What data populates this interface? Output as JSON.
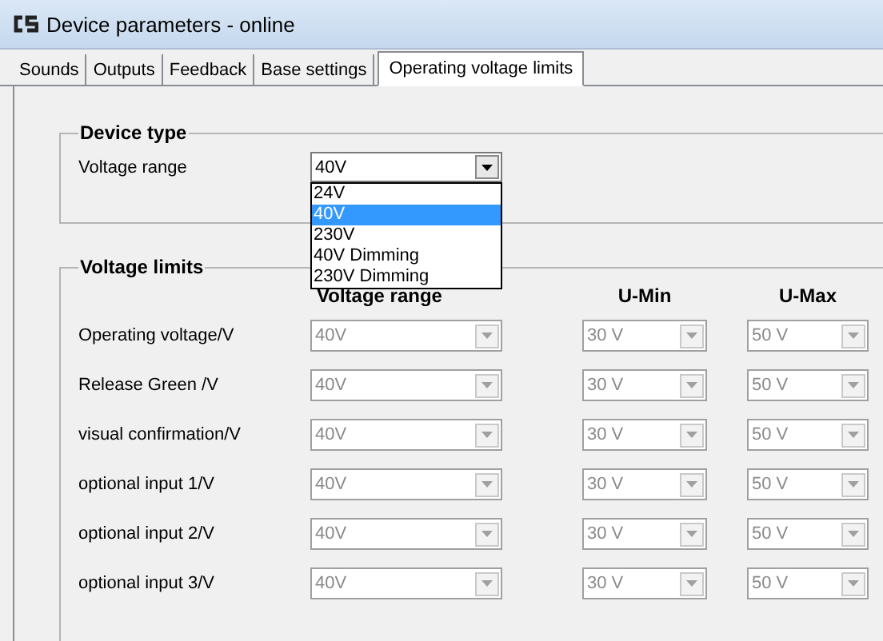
{
  "window": {
    "title": "Device parameters - online"
  },
  "tabs": [
    {
      "label": "Sounds",
      "selected": false
    },
    {
      "label": "Outputs",
      "selected": false
    },
    {
      "label": "Feedback",
      "selected": false
    },
    {
      "label": "Base settings",
      "selected": false
    },
    {
      "label": "Operating voltage limits",
      "selected": true
    }
  ],
  "device_type": {
    "title": "Device type",
    "label": "Voltage range",
    "value": "40V",
    "expanded": true,
    "options": [
      {
        "label": "24V",
        "selected": false
      },
      {
        "label": "40V",
        "selected": true
      },
      {
        "label": "230V",
        "selected": false
      },
      {
        "label": "40V Dimming",
        "selected": false
      },
      {
        "label": "230V Dimming",
        "selected": false
      }
    ]
  },
  "voltage_limits": {
    "title": "Voltage limits",
    "columns": [
      "Voltage range",
      "U-Min",
      "U-Max"
    ],
    "rows": [
      {
        "label": "Operating voltage/V",
        "range": "40V",
        "u_min": "30 V",
        "u_max": "50 V",
        "disabled": true
      },
      {
        "label": "Release Green /V",
        "range": "40V",
        "u_min": "30 V",
        "u_max": "50 V",
        "disabled": true
      },
      {
        "label": "visual confirmation/V",
        "range": "40V",
        "u_min": "30 V",
        "u_max": "50 V",
        "disabled": true
      },
      {
        "label": "optional input 1/V",
        "range": "40V",
        "u_min": "30 V",
        "u_max": "50 V",
        "disabled": true
      },
      {
        "label": "optional input 2/V",
        "range": "40V",
        "u_min": "30 V",
        "u_max": "50 V",
        "disabled": true
      },
      {
        "label": "optional input 3/V",
        "range": "40V",
        "u_min": "30 V",
        "u_max": "50 V",
        "disabled": true
      }
    ]
  }
}
